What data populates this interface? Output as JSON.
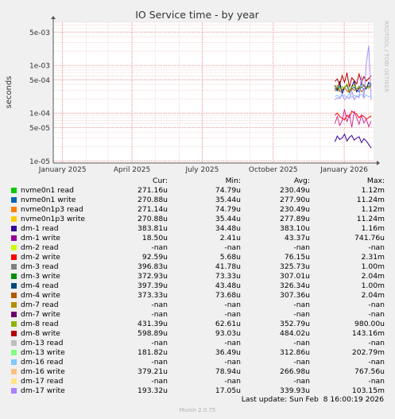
{
  "chart_data": {
    "type": "line",
    "title": "IO Service time - by year",
    "ylabel": "seconds",
    "yscale": "log",
    "ylim": [
      9e-06,
      0.008
    ],
    "xlim": [
      "2024-12-20",
      "2026-02-08"
    ],
    "y_ticks": [
      {
        "value": 0.005,
        "label": "5e-03"
      },
      {
        "value": 0.001,
        "label": "1e-03"
      },
      {
        "value": 0.0005,
        "label": "5e-04"
      },
      {
        "value": 0.0001,
        "label": "1e-04"
      },
      {
        "value": 5e-05,
        "label": "5e-05"
      },
      {
        "value": 1e-05,
        "label": "1e-05"
      }
    ],
    "x_ticks": [
      {
        "date": "2025-01-01",
        "label": "January 2025"
      },
      {
        "date": "2025-04-01",
        "label": "April 2025"
      },
      {
        "date": "2025-07-01",
        "label": "July 2025"
      },
      {
        "date": "2025-10-01",
        "label": "October 2025"
      },
      {
        "date": "2026-01-01",
        "label": "January 2026"
      }
    ],
    "grid": true,
    "data_start": "2025-12-23",
    "series": [
      {
        "name": "dm-1 read",
        "color": "#000066",
        "values": [
          0.00038,
          0.00031,
          0.00045,
          0.00026,
          0.00034,
          0.0004,
          0.00029,
          0.00036,
          0.00047,
          0.00028,
          0.00033,
          0.00041,
          0.00037,
          0.00032,
          0.00044,
          0.00038
        ]
      },
      {
        "name": "dm-1 write",
        "color": "#330099",
        "values": [
          2.5e-05,
          3.3e-05,
          2.8e-05,
          3e-05,
          3.6e-05,
          2.6e-05,
          3.1e-05,
          3.4e-05,
          2.7e-05,
          3e-05,
          3.2e-05,
          2.4e-05,
          2.9e-05,
          2.6e-05,
          2.2e-05,
          1.85e-05
        ]
      },
      {
        "name": "dm-4 read",
        "color": "#0066b3",
        "values": [
          0.00033,
          0.00029,
          0.00036,
          0.0003,
          0.00034,
          0.00038,
          0.00027,
          0.00032,
          0.00035,
          0.0003,
          0.00028,
          0.00036,
          0.00031,
          0.00033,
          0.00037,
          0.0004
        ]
      },
      {
        "name": "dm-4 write",
        "color": "#b35a00",
        "values": [
          0.00029,
          0.00034,
          0.00028,
          0.00031,
          0.00035,
          0.00029,
          0.00027,
          0.00033,
          0.0003,
          0.00032,
          0.00034,
          0.00028,
          0.00031,
          0.00036,
          0.00033,
          0.00037
        ]
      },
      {
        "name": "dm-8 read",
        "color": "#8fb300",
        "values": [
          0.00034,
          0.00038,
          0.00031,
          0.00036,
          0.00033,
          0.00041,
          0.00029,
          0.00035,
          0.00039,
          0.00032,
          0.00037,
          0.00034,
          0.0004,
          0.00036,
          0.00033,
          0.00043
        ]
      },
      {
        "name": "dm-8 write",
        "color": "#b30000",
        "values": [
          0.00046,
          0.00052,
          0.00039,
          0.00061,
          0.00044,
          0.0007,
          0.00035,
          0.00055,
          0.00048,
          0.00041,
          0.00066,
          0.00043,
          0.00058,
          0.00047,
          0.00053,
          0.0006
        ]
      },
      {
        "name": "dm-13 read",
        "color": "#ff0000",
        "values": [
          9e-05,
          0.0001,
          8.5e-05,
          7.8e-05,
          7.2e-05,
          9e-05,
          8.1e-05,
          0.00011,
          0.0001,
          9.5e-05,
          8e-05,
          9e-05,
          8.5e-05,
          7.5e-05,
          8e-05,
          8.8e-05
        ]
      },
      {
        "name": "dm-13 write",
        "color": "#cc3399",
        "values": [
          6e-05,
          8.5e-05,
          5.5e-05,
          7e-05,
          0.00012,
          6.5e-05,
          9.5e-05,
          5e-05,
          0.00011,
          8e-05,
          5.8e-05,
          9e-05,
          6.2e-05,
          7.5e-05,
          5.2e-05,
          6.8e-05
        ]
      },
      {
        "name": "dm-16 read",
        "color": "#8ccbff",
        "values": [
          0.00022,
          0.00024,
          0.00021,
          0.00025,
          0.00023,
          0.00022,
          0.00026,
          0.00021,
          0.00024,
          0.00022,
          0.00023,
          0.00025,
          0.00021,
          0.00024,
          0.00022,
          0.00023
        ]
      },
      {
        "name": "dm-17 write",
        "color": "#a693ff",
        "values": [
          0.00019,
          0.00021,
          0.0002,
          0.00024,
          0.00019,
          0.00022,
          0.0002,
          0.00029,
          0.00019,
          0.00023,
          0.00021,
          0.0006,
          0.0002,
          0.0011,
          0.0026,
          0.00019
        ]
      }
    ]
  },
  "watermark": "RRDTOOL / TOBI OETIKER",
  "legend": {
    "columns": {
      "cur": "Cur:",
      "min": "Min:",
      "avg": "Avg:",
      "max": "Max:"
    },
    "rows": [
      {
        "name": "nvme0n1 read",
        "color": "#00cc00",
        "cur": "271.16u",
        "min": "74.79u",
        "avg": "230.49u",
        "max": "1.12m"
      },
      {
        "name": "nvme0n1 write",
        "color": "#0066b3",
        "cur": "270.88u",
        "min": "35.44u",
        "avg": "277.90u",
        "max": "11.24m"
      },
      {
        "name": "nvme0n1p3 read",
        "color": "#ff8000",
        "cur": "271.14u",
        "min": "74.79u",
        "avg": "230.49u",
        "max": "1.12m"
      },
      {
        "name": "nvme0n1p3 write",
        "color": "#ffcc00",
        "cur": "270.88u",
        "min": "35.44u",
        "avg": "277.89u",
        "max": "11.24m"
      },
      {
        "name": "dm-1 read",
        "color": "#330099",
        "cur": "383.81u",
        "min": "34.48u",
        "avg": "383.10u",
        "max": "1.16m"
      },
      {
        "name": "dm-1 write",
        "color": "#990099",
        "cur": "18.50u",
        "min": "2.41u",
        "avg": "43.37u",
        "max": "741.76u"
      },
      {
        "name": "dm-2 read",
        "color": "#ccff00",
        "cur": "-nan",
        "min": "-nan",
        "avg": "-nan",
        "max": "-nan"
      },
      {
        "name": "dm-2 write",
        "color": "#ff0000",
        "cur": "92.59u",
        "min": "5.68u",
        "avg": "76.15u",
        "max": "2.31m"
      },
      {
        "name": "dm-3 read",
        "color": "#808080",
        "cur": "396.83u",
        "min": "41.78u",
        "avg": "325.73u",
        "max": "1.00m"
      },
      {
        "name": "dm-3 write",
        "color": "#008f00",
        "cur": "372.93u",
        "min": "73.33u",
        "avg": "307.01u",
        "max": "2.04m"
      },
      {
        "name": "dm-4 read",
        "color": "#00487d",
        "cur": "397.39u",
        "min": "43.48u",
        "avg": "326.34u",
        "max": "1.00m"
      },
      {
        "name": "dm-4 write",
        "color": "#b35a00",
        "cur": "373.33u",
        "min": "73.68u",
        "avg": "307.36u",
        "max": "2.04m"
      },
      {
        "name": "dm-7 read",
        "color": "#b38f00",
        "cur": "-nan",
        "min": "-nan",
        "avg": "-nan",
        "max": "-nan"
      },
      {
        "name": "dm-7 write",
        "color": "#6b006b",
        "cur": "-nan",
        "min": "-nan",
        "avg": "-nan",
        "max": "-nan"
      },
      {
        "name": "dm-8 read",
        "color": "#8fb300",
        "cur": "431.39u",
        "min": "62.61u",
        "avg": "352.79u",
        "max": "980.00u"
      },
      {
        "name": "dm-8 write",
        "color": "#b30000",
        "cur": "598.89u",
        "min": "93.03u",
        "avg": "484.02u",
        "max": "143.16m"
      },
      {
        "name": "dm-13 read",
        "color": "#bebebe",
        "cur": "-nan",
        "min": "-nan",
        "avg": "-nan",
        "max": "-nan"
      },
      {
        "name": "dm-13 write",
        "color": "#80ff80",
        "cur": "181.82u",
        "min": "36.49u",
        "avg": "312.86u",
        "max": "202.79m"
      },
      {
        "name": "dm-16 read",
        "color": "#80c9ff",
        "cur": "-nan",
        "min": "-nan",
        "avg": "-nan",
        "max": "-nan"
      },
      {
        "name": "dm-16 write",
        "color": "#ffc080",
        "cur": "379.21u",
        "min": "78.94u",
        "avg": "266.98u",
        "max": "767.56u"
      },
      {
        "name": "dm-17 read",
        "color": "#ffe680",
        "cur": "-nan",
        "min": "-nan",
        "avg": "-nan",
        "max": "-nan"
      },
      {
        "name": "dm-17 write",
        "color": "#aa80ff",
        "cur": "193.32u",
        "min": "17.05u",
        "avg": "339.93u",
        "max": "103.15m"
      }
    ]
  },
  "footer": {
    "last_update": "Last update: Sun Feb  8 16:00:19 2026",
    "version": "Munin 2.0.75"
  }
}
